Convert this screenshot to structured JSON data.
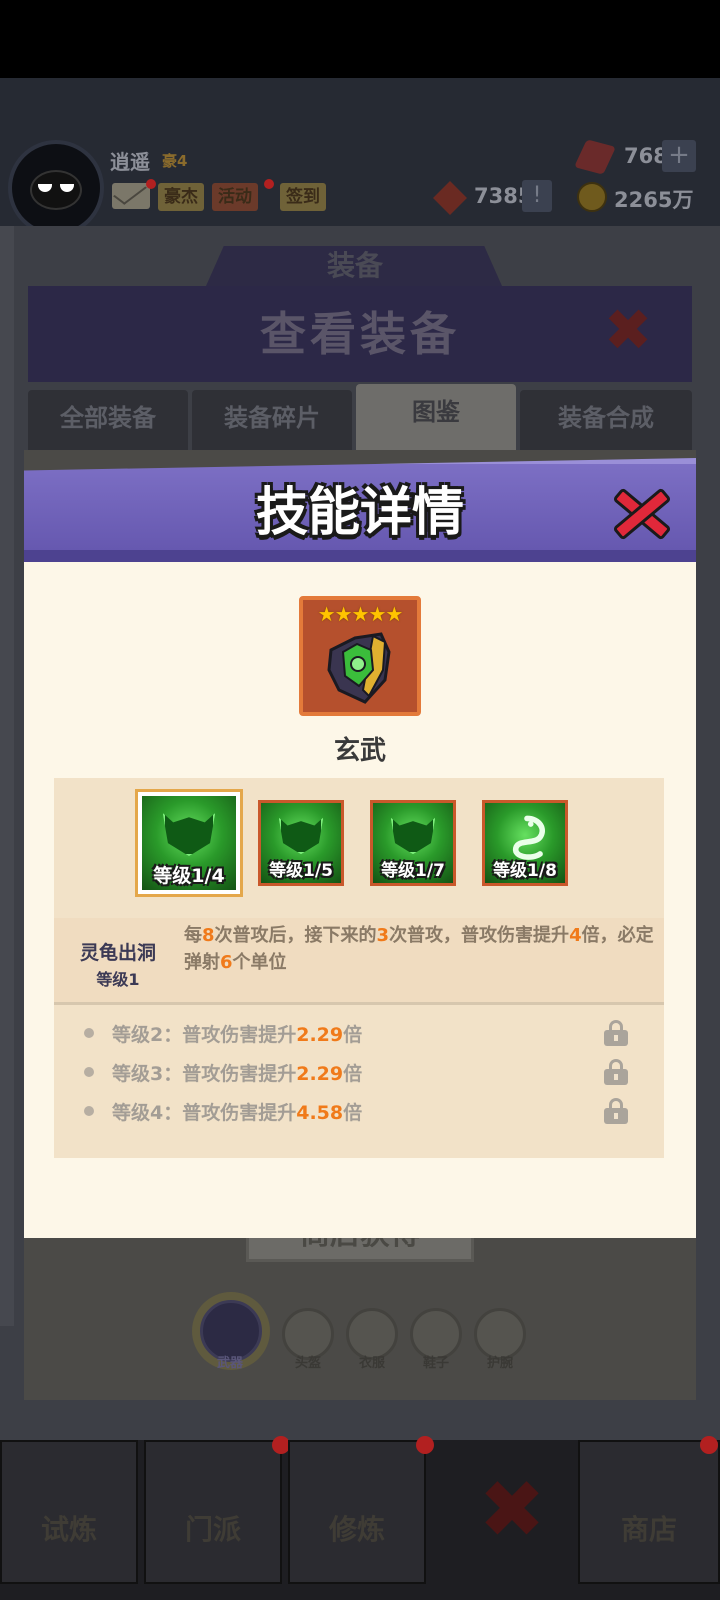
{
  "header": {
    "username": "逍遥",
    "vip": "豪4",
    "buttons": [
      "豪杰",
      "活动",
      "签到"
    ],
    "gems": "768",
    "red_currency": "7385",
    "gold": "2265万",
    "plus_symbol": "+",
    "exclaim_symbol": "!"
  },
  "background": {
    "section_tab": "装备",
    "panel_title": "查看装备",
    "close_glyph": "✖",
    "tabs": [
      "全部装备",
      "装备碎片",
      "图鉴",
      "装备合成"
    ],
    "action_button": "商店获得",
    "slots": [
      "武器",
      "头盔",
      "衣服",
      "鞋子",
      "护腕"
    ]
  },
  "bottom_nav": [
    "试炼",
    "门派",
    "修炼",
    "商店"
  ],
  "modal": {
    "title": "技能详情",
    "item_name": "玄武",
    "stars": "★★★★★",
    "skills": [
      {
        "level": "等级1/4",
        "selected": true
      },
      {
        "level": "等级1/5",
        "selected": false
      },
      {
        "level": "等级1/7",
        "selected": false
      },
      {
        "level": "等级1/8",
        "selected": false
      }
    ],
    "skill_name": "灵龟出洞",
    "skill_level": "等级1",
    "skill_desc": {
      "p1": "每",
      "n1": "8",
      "p2": "次普攻后，接下来的",
      "n2": "3",
      "p3": "次普攻，普攻伤害提升",
      "n3": "4",
      "p4": "倍，必定弹射",
      "n4": "6",
      "p5": "个单位"
    },
    "upgrades": [
      {
        "label": "等级2：普攻伤害提升",
        "value": "2.29",
        "suffix": "倍",
        "locked": true
      },
      {
        "label": "等级3：普攻伤害提升",
        "value": "2.29",
        "suffix": "倍",
        "locked": true
      },
      {
        "label": "等级4：普攻伤害提升",
        "value": "4.58",
        "suffix": "倍",
        "locked": true
      }
    ]
  }
}
